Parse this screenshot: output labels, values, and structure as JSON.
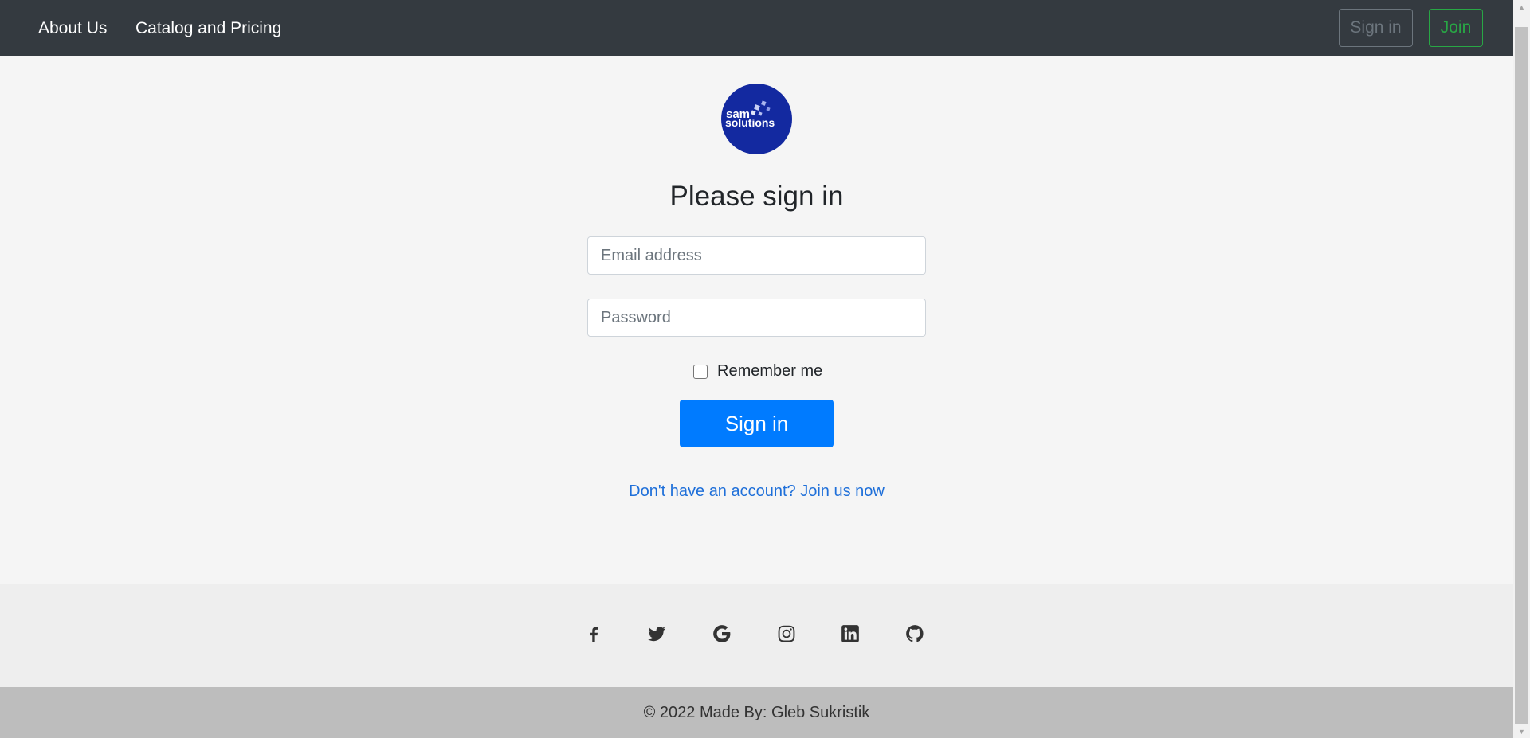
{
  "navbar": {
    "links": [
      {
        "label": "About Us"
      },
      {
        "label": "Catalog and Pricing"
      }
    ],
    "signin_label": "Sign in",
    "join_label": "Join"
  },
  "logo": {
    "line1": "sam",
    "line2": "solutions",
    "color": "#1329a0"
  },
  "form": {
    "heading": "Please sign in",
    "email_placeholder": "Email address",
    "password_placeholder": "Password",
    "remember_label": "Remember me",
    "submit_label": "Sign in",
    "join_link": "Don't have an account? Join us now"
  },
  "social": {
    "icons": [
      "facebook-icon",
      "twitter-icon",
      "google-icon",
      "instagram-icon",
      "linkedin-icon",
      "github-icon"
    ]
  },
  "footer": {
    "copyright": "© 2022 Made By: Gleb Sukristik"
  },
  "colors": {
    "navbar_bg": "#343a40",
    "primary": "#007bff",
    "success": "#28a745",
    "secondary": "#6c757d",
    "link": "#1e6fd9"
  }
}
